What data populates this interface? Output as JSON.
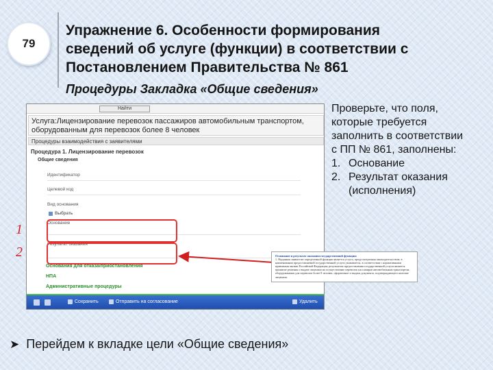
{
  "slide": {
    "number": "79",
    "title_lines": [
      "Упражнение 6. Особенности формирования",
      "сведений об услуге (функции) в соответствии с",
      "Постановлением Правительства № 861"
    ],
    "subtitle": "Процедуры Закладка «Общие сведения»",
    "check_intro_lines": [
      "Проверьте, что поля,",
      "которые требуется",
      "заполнить в соответствии",
      "с ПП № 861, заполнены:"
    ],
    "check_items": [
      {
        "num": "1.",
        "text": "Основание"
      },
      {
        "num": "2.",
        "text": "Результат оказания (исполнения)"
      }
    ],
    "bullet_text": "Перейдем к вкладке цели «Общие сведения»",
    "bullet_icon": "arrow-bullet-icon",
    "markers": [
      "1",
      "2"
    ]
  },
  "screenshot": {
    "find_button": "Найти",
    "service_title_lines": [
      "Услуга:Лицензирование перевозок пассажиров автомобильным транспортом,",
      "оборудованным для перевозок более 8 человек"
    ],
    "procedures_bar": "Процедуры взаимодействия с заявителями",
    "procedure_title": "Процедура 1. Лицензирование перевозок",
    "tab_general": "Общие сведения",
    "fields": {
      "identifier": "Идентификатор",
      "target_group": "Целевой код",
      "reason_kind": "Вид основания",
      "choose_button": "Выбрать",
      "basis": "Основание",
      "result": "Результат оказания *"
    },
    "sections": [
      "Основания для отказа/приостановления",
      "НПА",
      "Административные процедуры"
    ],
    "toolbar": {
      "save": "Сохранить",
      "send": "Отправить на согласование",
      "delete": "Удалить"
    }
  },
  "doc_snippet": {
    "heading": "Основание и результат оказания государственной функции:",
    "body": "1. Выданная заявителю определенной функции является услуга, предусмотренная законодательством; в наименовании предоставляемой государственной услуги указывается, в соответствии с нормативными правовыми актами Российской Федерации; результатом предоставления государственной услуги является принятие решения о выдаче лицензии на осуществление перевозок пассажиров автомобильным транспортом, оборудованным для перевозок более 8 человек, оформление и выдача документа, подтверждающего наличие лицензии."
  },
  "colors": {
    "highlight": "#e03030",
    "marker": "#d01f1f",
    "toolbar": "#1f4fae",
    "accent_green": "#2e8b2e"
  }
}
